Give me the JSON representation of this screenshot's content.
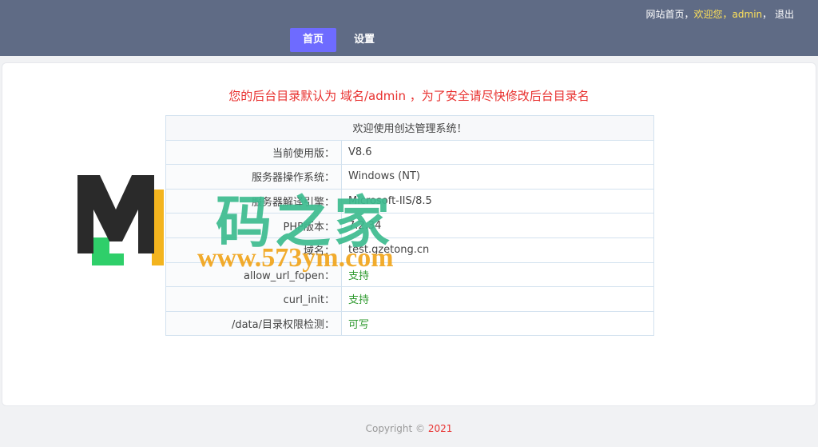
{
  "header": {
    "links": {
      "home": "网站首页",
      "sep1": "，",
      "welcome": "欢迎您，admin",
      "sep2": "，",
      "logout": "退出"
    },
    "nav": [
      {
        "label": "首页",
        "active": true
      },
      {
        "label": "设置",
        "active": false
      }
    ]
  },
  "main": {
    "notice": "您的后台目录默认为 域名/admin ，为了安全请尽快修改后台目录名",
    "table_title": "欢迎使用创达管理系统！",
    "rows": [
      {
        "key": "当前使用版：",
        "value": "V8.6"
      },
      {
        "key": "服务器操作系统：",
        "value": "Windows (NT)"
      },
      {
        "key": "服务器解译引擎：",
        "value": "Microsoft-IIS/8.5"
      },
      {
        "key": "PHP版本：",
        "value": "7.2.34"
      },
      {
        "key": "域名：",
        "value": "test.gzetong.cn"
      },
      {
        "key": "allow_url_fopen：",
        "value": "支持"
      },
      {
        "key": "curl_init：",
        "value": "支持"
      },
      {
        "key": "/data/目录权限检测：",
        "value": "可写"
      }
    ]
  },
  "watermark": {
    "cn_text": "码之家",
    "url_text": "www.573ym.com"
  },
  "footer": {
    "copyright": "Copyright © ",
    "year": "2021"
  },
  "colors": {
    "topbar": "#5f6b85",
    "active_tab": "#6e6bff",
    "notice": "#e8312f",
    "ok": "#2f9a2f"
  }
}
